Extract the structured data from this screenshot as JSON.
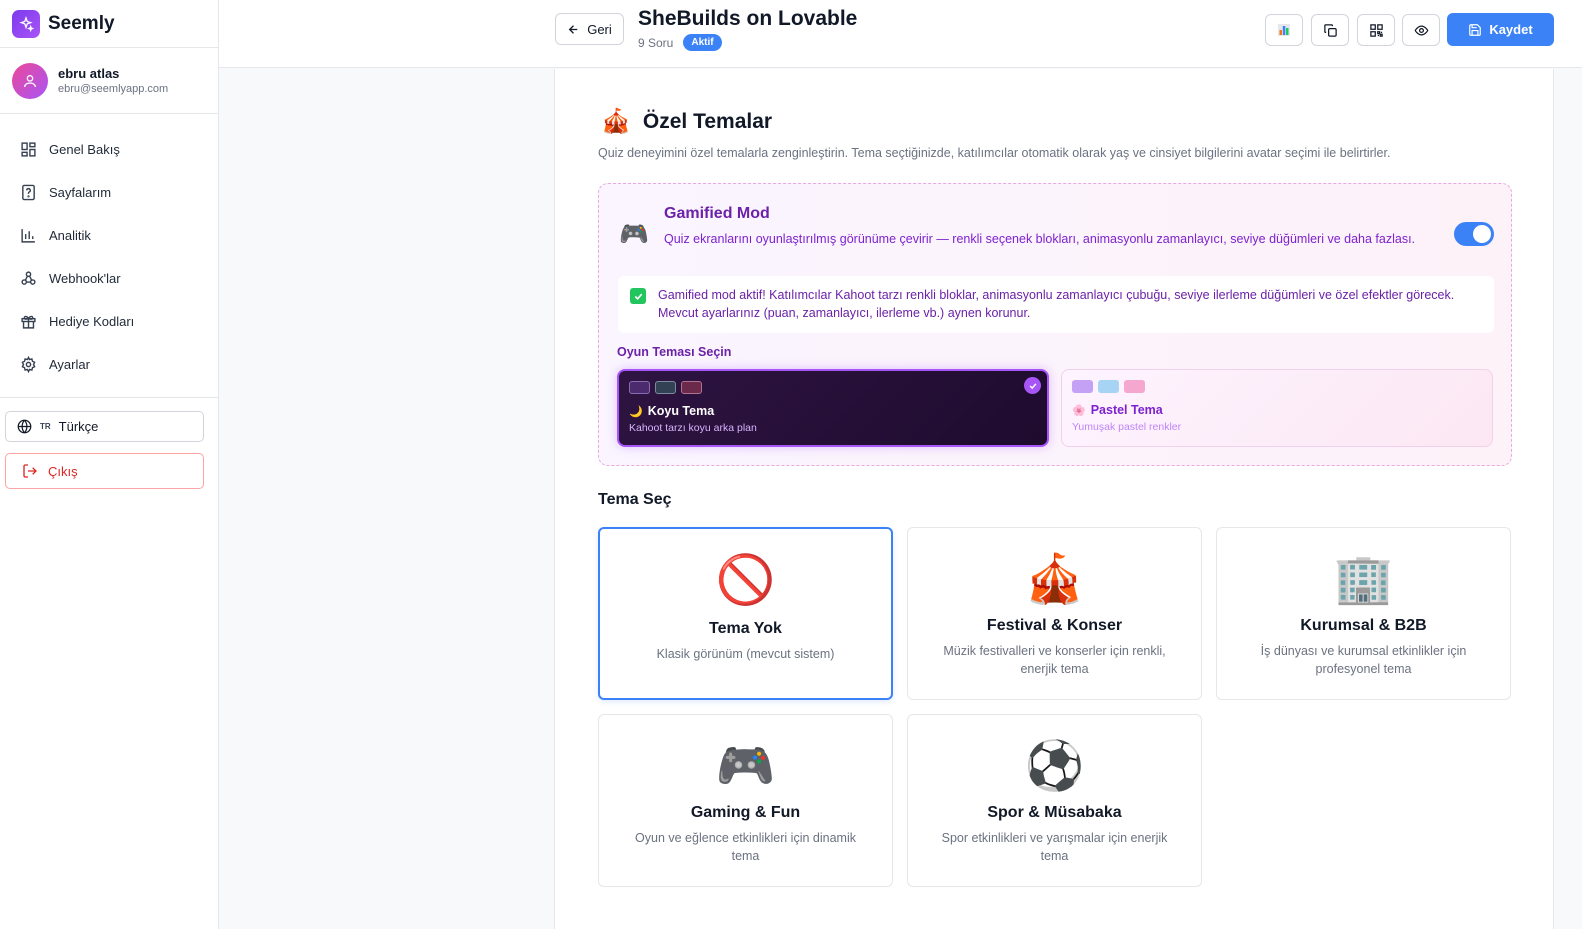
{
  "brand": {
    "name": "Seemly"
  },
  "user": {
    "name": "ebru atlas",
    "email": "ebru@seemlyapp.com"
  },
  "nav": {
    "items": [
      {
        "label": "Genel Bakış",
        "icon": "grid-icon"
      },
      {
        "label": "Sayfalarım",
        "icon": "question-file-icon"
      },
      {
        "label": "Analitik",
        "icon": "bar-chart-icon"
      },
      {
        "label": "Webhook'lar",
        "icon": "webhook-icon"
      },
      {
        "label": "Hediye Kodları",
        "icon": "gift-icon"
      },
      {
        "label": "Ayarlar",
        "icon": "gear-icon"
      }
    ]
  },
  "language": {
    "code": "TR",
    "label": "Türkçe"
  },
  "logout": {
    "label": "Çıkış"
  },
  "header": {
    "back_label": "Geri",
    "title": "SheBuilds on Lovable",
    "question_count": "9 Soru",
    "status": "Aktif",
    "save_label": "Kaydet"
  },
  "custom_themes": {
    "title": "Özel Temalar",
    "emoji": "🎪",
    "description": "Quiz deneyimini özel temalarla zenginleştirin. Tema seçtiğinizde, katılımcılar otomatik olarak yaş ve cinsiyet bilgilerini avatar seçimi ile belirtirler."
  },
  "gamified": {
    "emoji": "🎮",
    "title": "Gamified Mod",
    "description": "Quiz ekranlarını oyunlaştırılmış görünüme çevirir — renkli seçenek blokları, animasyonlu zamanlayıcı, seviye düğümleri ve daha fazlası.",
    "enabled": true,
    "active_note": "Gamified mod aktif! Katılımcılar Kahoot tarzı renkli bloklar, animasyonlu zamanlayıcı çubuğu, seviye ilerleme düğümleri ve özel efektler görecek. Mevcut ayarlarınız (puan, zamanlayıcı, ilerleme vb.) aynen korunur.",
    "game_theme_label": "Oyun Teması Seçin",
    "options": [
      {
        "emoji": "🌙",
        "name": "Koyu Tema",
        "sub": "Kahoot tarzı koyu arka plan",
        "selected": true,
        "swatches": [
          "#4c2a6e",
          "#334155",
          "#6b2a4a"
        ]
      },
      {
        "emoji": "🌸",
        "name": "Pastel Tema",
        "sub": "Yumuşak pastel renkler",
        "selected": false,
        "swatches": [
          "#c4a1f5",
          "#a7d3f5",
          "#f5a7cf"
        ]
      }
    ]
  },
  "theme_select": {
    "title": "Tema Seç",
    "tiles": [
      {
        "emoji": "🚫",
        "name": "Tema Yok",
        "desc": "Klasik görünüm (mevcut sistem)",
        "selected": true
      },
      {
        "emoji": "🎪",
        "name": "Festival & Konser",
        "desc": "Müzik festivalleri ve konserler için renkli, enerjik tema",
        "selected": false
      },
      {
        "emoji": "🏢",
        "name": "Kurumsal & B2B",
        "desc": "İş dünyası ve kurumsal etkinlikler için profesyonel tema",
        "selected": false
      },
      {
        "emoji": "🎮",
        "name": "Gaming & Fun",
        "desc": "Oyun ve eğlence etkinlikleri için dinamik tema",
        "selected": false
      },
      {
        "emoji": "⚽",
        "name": "Spor & Müsabaka",
        "desc": "Spor etkinlikleri ve yarışmalar için enerjik tema",
        "selected": false
      }
    ]
  },
  "colors": {
    "primary": "#3b82f6",
    "purple": "#a855f7",
    "danger": "#dc2626"
  }
}
